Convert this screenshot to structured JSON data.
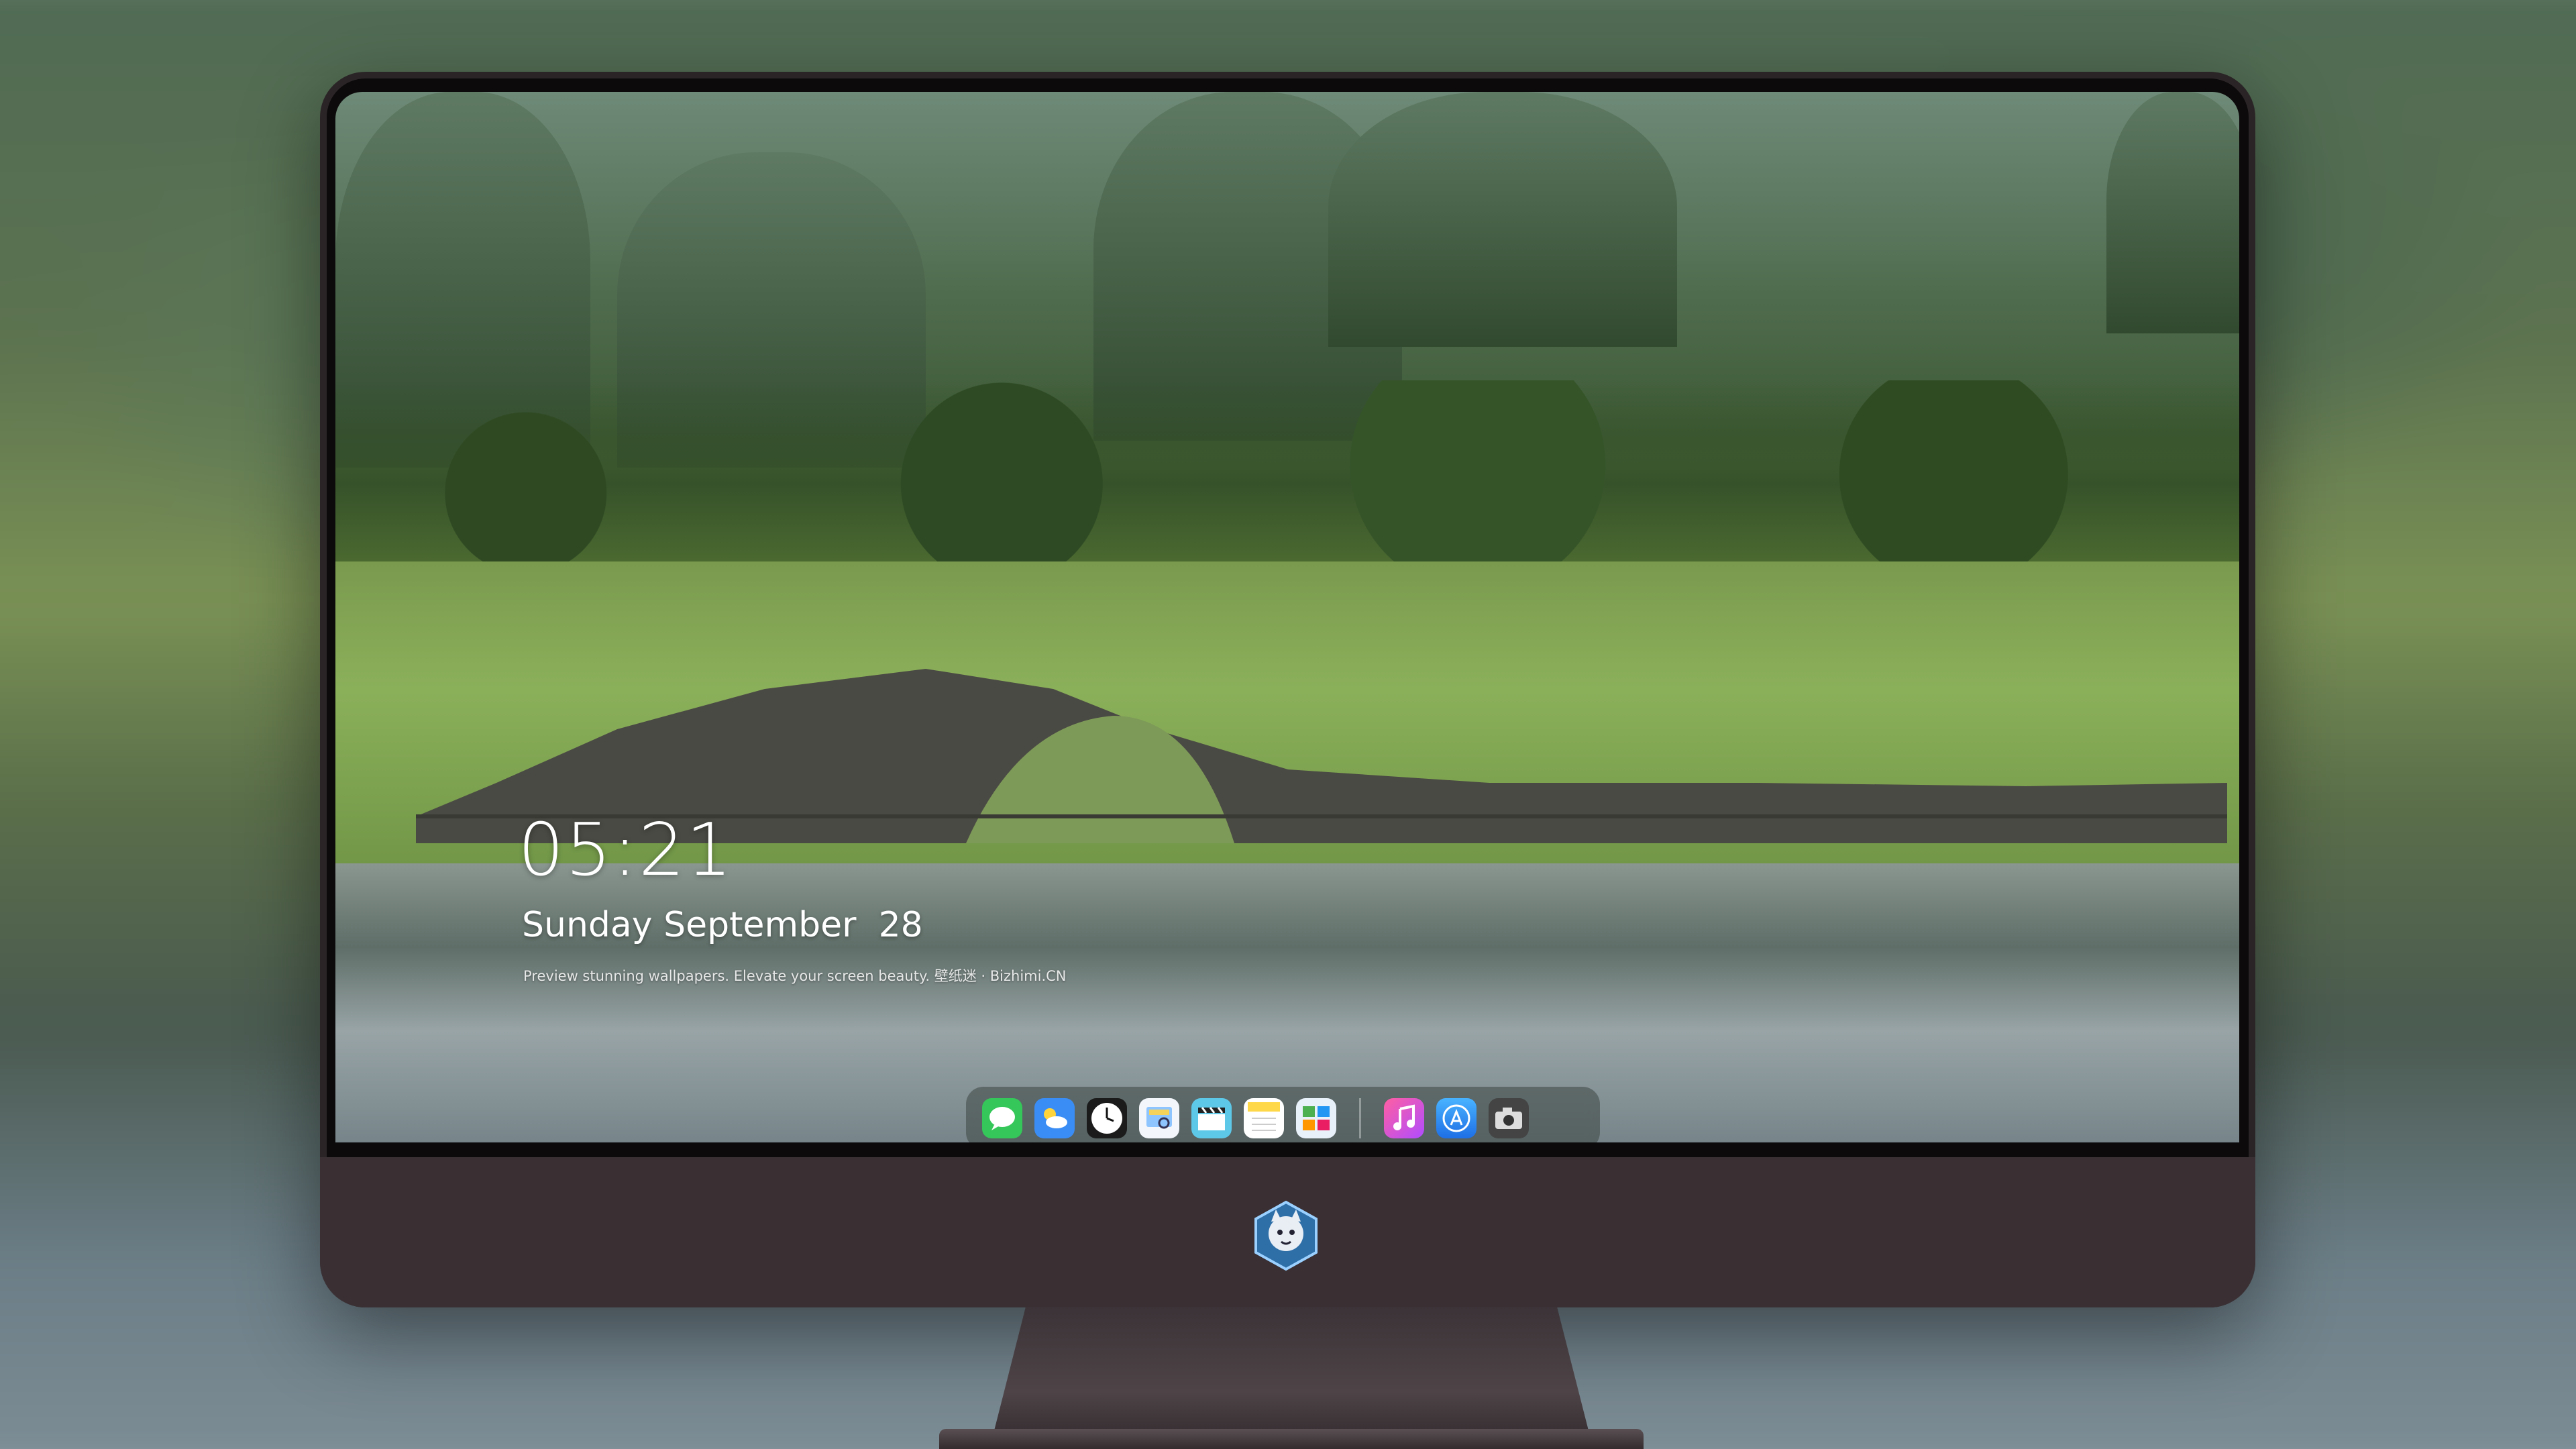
{
  "lockscreen": {
    "time": "05:21",
    "date": "Sunday September  28",
    "tagline": "Preview stunning wallpapers. Elevate your screen beauty. 壁纸迷 · Bizhimi.CN"
  },
  "dock": {
    "apps": [
      {
        "name": "messages",
        "icon": "messages-icon",
        "color": "#35c759"
      },
      {
        "name": "weather",
        "icon": "weather-icon",
        "color": "#3a8df5"
      },
      {
        "name": "clock",
        "icon": "clock-icon",
        "color": "#ffffff"
      },
      {
        "name": "preview",
        "icon": "preview-icon",
        "color": "#f5d35a"
      },
      {
        "name": "clips",
        "icon": "clapperboard-icon",
        "color": "#5ec8e8"
      },
      {
        "name": "notes",
        "icon": "notes-icon",
        "color": "#ffd84a"
      },
      {
        "name": "photo-gallery",
        "icon": "photos-icon",
        "color": "#4caf50"
      },
      {
        "name": "music",
        "icon": "music-icon",
        "color": "#e040fb"
      },
      {
        "name": "app-store",
        "icon": "app-store-icon",
        "color": "#1e88e5"
      },
      {
        "name": "camera",
        "icon": "camera-icon",
        "color": "#555555"
      }
    ]
  },
  "monitor": {
    "logo": "wolf-mascot-icon"
  }
}
